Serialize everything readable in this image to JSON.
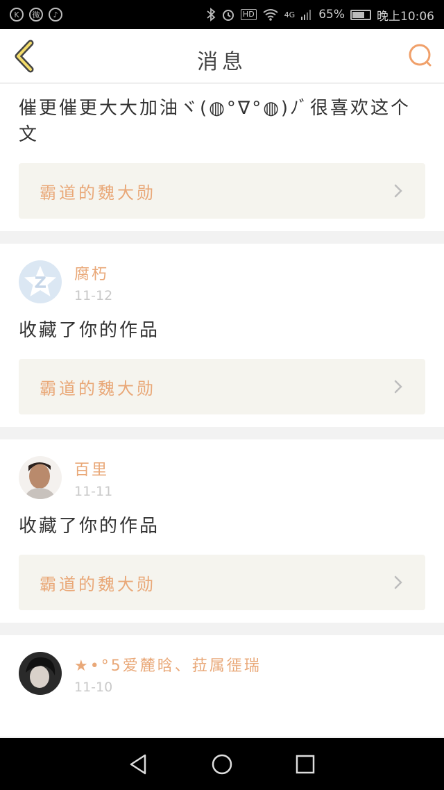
{
  "status_bar": {
    "app_icons": [
      "K",
      "微",
      "♪"
    ],
    "hd": "HD",
    "network": "4G",
    "battery": "65%",
    "battery_level": 0.65,
    "time": "晚上10:06"
  },
  "header": {
    "title": "消息",
    "accent": "#f0a06a"
  },
  "notifications": [
    {
      "message": "催更催更大大加油ヾ(◍°∇°◍)ﾉﾞ很喜欢这个文",
      "work_title": "霸道的魏大勋"
    },
    {
      "username": "腐朽",
      "date": "11-12",
      "message": "收藏了你的作品",
      "work_title": "霸道的魏大勋"
    },
    {
      "username": "百里",
      "date": "11-11",
      "message": "收藏了你的作品",
      "work_title": "霸道的魏大勋"
    },
    {
      "username": "★•°5爱麓晗、菈属徰瑞",
      "date": "11-10"
    }
  ],
  "colors": {
    "accent": "#e9a878",
    "card_link_bg": "#f5f4ee",
    "page_bg": "#f2f2f2"
  }
}
